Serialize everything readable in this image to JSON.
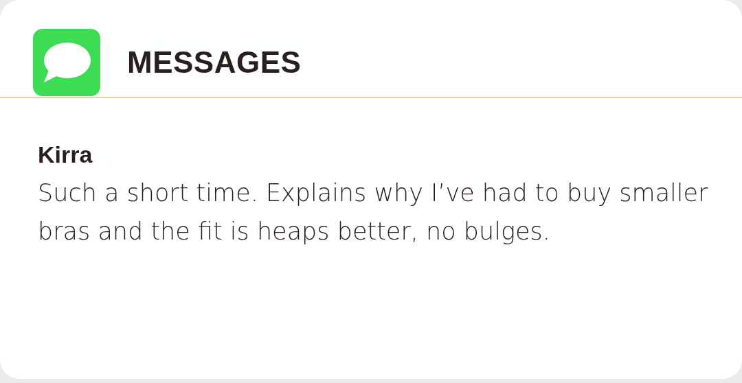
{
  "app": {
    "title": "MESSAGES"
  },
  "message": {
    "sender": "Kirra",
    "text": "Such a short time. Explains why I’ve had to buy smaller bras and the fit is heaps better, no bulges."
  }
}
